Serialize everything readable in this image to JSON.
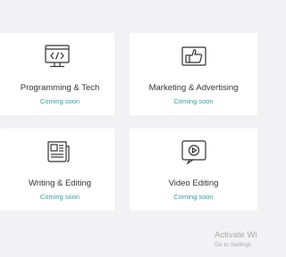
{
  "cards": [
    {
      "title": "Programming & Tech",
      "status": "Coming soon",
      "icon": "monitor-code-icon"
    },
    {
      "title": "Marketing & Advertising",
      "status": "Coming soon",
      "icon": "thumbs-up-icon"
    },
    {
      "title": "Writing & Editing",
      "status": "Coming soon",
      "icon": "document-edit-icon"
    },
    {
      "title": "Video Editing",
      "status": "Coming soon",
      "icon": "play-video-icon"
    }
  ],
  "watermark": {
    "title": "Activate Wi",
    "subtitle": "Go to Settings"
  },
  "colors": {
    "background": "#f2f2f4",
    "card": "#ffffff",
    "title_text": "#333333",
    "status_text": "#2aa39a",
    "icon_stroke": "#333333"
  }
}
